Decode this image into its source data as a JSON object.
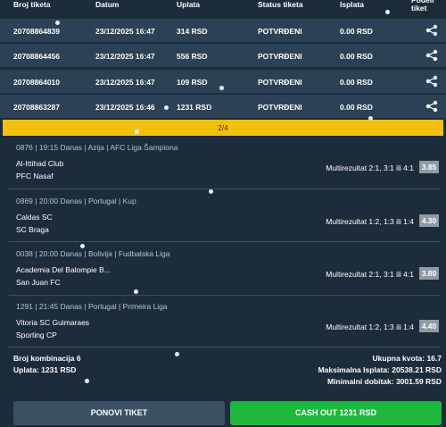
{
  "table_header": {
    "col_ticket": "Broj tiketa",
    "col_date": "Datum",
    "col_stake": "Uplata",
    "col_status": "Status tiketa",
    "col_payout": "Isplata",
    "col_share": "Podeli tiket"
  },
  "tickets": [
    {
      "id": "20708864839",
      "date": "23/12/2025 16:47",
      "stake": "314 RSD",
      "status": "POTVRĐENI",
      "payout": "0.00 RSD"
    },
    {
      "id": "20708864456",
      "date": "23/12/2025 16:47",
      "stake": "556 RSD",
      "status": "POTVRĐENI",
      "payout": "0.00 RSD"
    },
    {
      "id": "20708864010",
      "date": "23/12/2025 16:47",
      "stake": "109 RSD",
      "status": "POTVRĐENI",
      "payout": "0.00 RSD"
    },
    {
      "id": "20708863287",
      "date": "23/12/2025 16:46",
      "stake": "1231 RSD",
      "status": "POTVRĐENI",
      "payout": "0.00 RSD"
    }
  ],
  "pager": {
    "text": "2/4"
  },
  "matches": [
    {
      "meta": "0876 | 19:15 Danas | Azija | AFC Liga Šampiona",
      "home": "Al-Ittihad Club",
      "away": "PFC Nasaf",
      "pick": "Multirezultat 2:1, 3:1 ili 4:1",
      "odd": "3.85"
    },
    {
      "meta": "0869 | 20:00 Danas | Portugal | Kup",
      "home": "Caldas SC",
      "away": "SC Braga",
      "pick": "Multirezultat 1:2, 1:3 ili 1:4",
      "odd": "4.30"
    },
    {
      "meta": "0038 | 20:00 Danas | Bolivija | Fudbalska Liga",
      "home": "Academia Del Balompie B...",
      "away": "San Juan FC",
      "pick": "Multirezultat 2:1, 3:1 ili 4:1",
      "odd": "3.80"
    },
    {
      "meta": "1291 | 21:45 Danas | Portugal | Primeira Liga",
      "home": "Vitoria SC Guimaraes",
      "away": "Sporting CP",
      "pick": "Multirezultat 1:2, 1:3 ili 1:4",
      "odd": "4.40"
    }
  ],
  "summary": {
    "combinations": "Broj kombinacija 6",
    "stake": "Uplata: 1231 RSD",
    "total_odds": "Ukupna kvota: 16.7",
    "max_payout": "Maksimalna Isplata: 20538.21 RSD",
    "min_win": "Minimalni dobitak: 3001.59 RSD"
  },
  "buttons": {
    "repeat": "PONOVI TIKET",
    "cashout": "CASH OUT 1231 RSD"
  },
  "icons": {
    "share": "share-icon"
  },
  "colors": {
    "accent": "#f2c110",
    "cashout": "#1eb83d",
    "row": "#2c4156",
    "background": "#1d2c3b"
  }
}
